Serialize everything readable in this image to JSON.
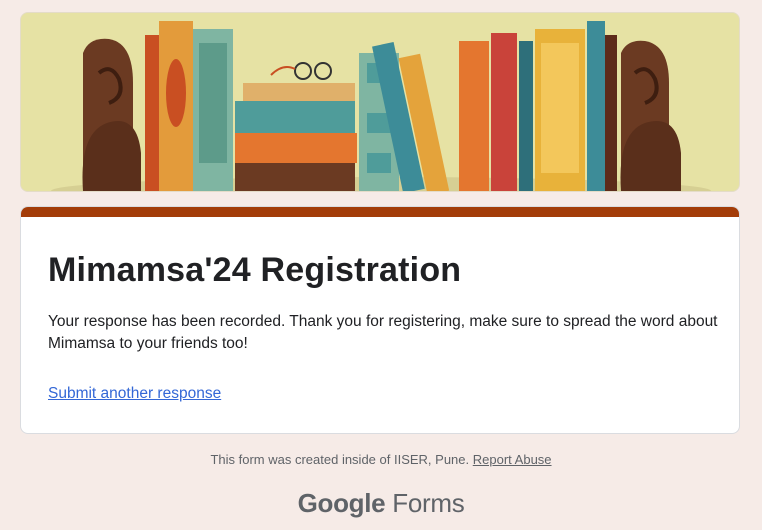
{
  "banner": {
    "alt": "bookshelf illustration"
  },
  "form": {
    "title": "Mimamsa'24 Registration",
    "confirmation": "Your response has been recorded. Thank you for registering, make sure to spread the word about Mimamsa to your friends too!",
    "submit_another": "Submit another response"
  },
  "footer": {
    "created_text": "This form was created inside of IISER, Pune.",
    "report_abuse": "Report Abuse",
    "brand_google": "Google",
    "brand_forms": "Forms"
  },
  "colors": {
    "accent": "#a33c08",
    "link": "#3367d6",
    "background": "#f6ebe7"
  }
}
